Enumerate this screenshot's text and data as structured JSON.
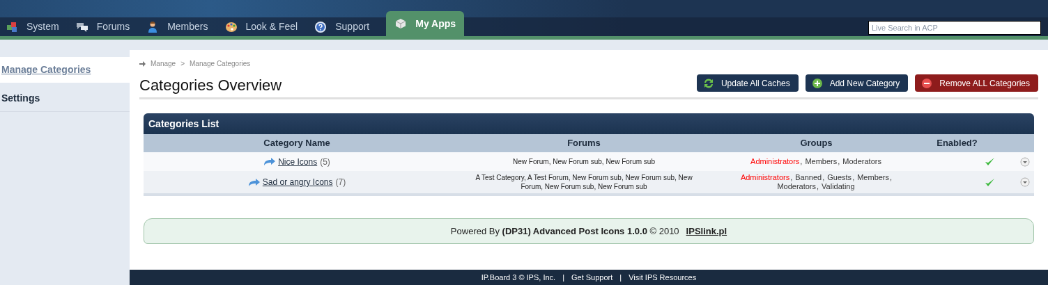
{
  "nav_tabs": [
    {
      "label": "System",
      "selected": false
    },
    {
      "label": "Forums",
      "selected": false
    },
    {
      "label": "Members",
      "selected": false
    },
    {
      "label": "Look & Feel",
      "selected": false
    },
    {
      "label": "Support",
      "selected": false
    },
    {
      "label": "My Apps",
      "selected": true
    }
  ],
  "group_separator": ",",
  "search": {
    "placeholder": "Live Search in ACP"
  },
  "sidebar": {
    "items": [
      {
        "label": "Manage Categories",
        "selected": true
      },
      {
        "label": "Settings",
        "selected": false
      }
    ]
  },
  "breadcrumb": [
    "Manage",
    "Manage Categories"
  ],
  "breadcrumb_separator": ">",
  "page_title": "Categories Overview",
  "actions": [
    {
      "label": "Update All Caches",
      "kind": "refresh"
    },
    {
      "label": "Add New Category",
      "kind": "add"
    },
    {
      "label": "Remove ALL Categories",
      "kind": "remove"
    }
  ],
  "table": {
    "title": "Categories List",
    "columns": [
      "Category Name",
      "Forums",
      "Groups",
      "Enabled?"
    ],
    "rows": [
      {
        "name": "Nice Icons",
        "count": "(5)",
        "forums": "New Forum, New Forum sub, New Forum sub",
        "groups": [
          {
            "name": "Administrators",
            "color": "#ff0000"
          },
          {
            "name": "Members",
            "color": "#333333"
          },
          {
            "name": "Moderators",
            "color": "#333333"
          }
        ],
        "enabled": true
      },
      {
        "name": "Sad or angry Icons",
        "count": "(7)",
        "forums": "A Test Category, A Test Forum, New Forum sub, New Forum sub, New Forum, New Forum sub, New Forum sub",
        "groups": [
          {
            "name": "Administrators",
            "color": "#ff0000"
          },
          {
            "name": "Banned",
            "color": "#333333"
          },
          {
            "name": "Guests",
            "color": "#333333"
          },
          {
            "name": "Members",
            "color": "#333333"
          },
          {
            "name": "Moderators",
            "color": "#333333"
          },
          {
            "name": "Validating",
            "color": "#333333"
          }
        ],
        "enabled": true
      }
    ]
  },
  "powered_by": {
    "text": "Powered By **(DP31) Advanced Post Icons 1.0.0** © 2010",
    "link": "IPSlink.pl"
  },
  "footer": [
    "IP.Board 3 © IPS, Inc.",
    "Get Support",
    "Visit IPS Resources"
  ],
  "footer_separator": "|"
}
